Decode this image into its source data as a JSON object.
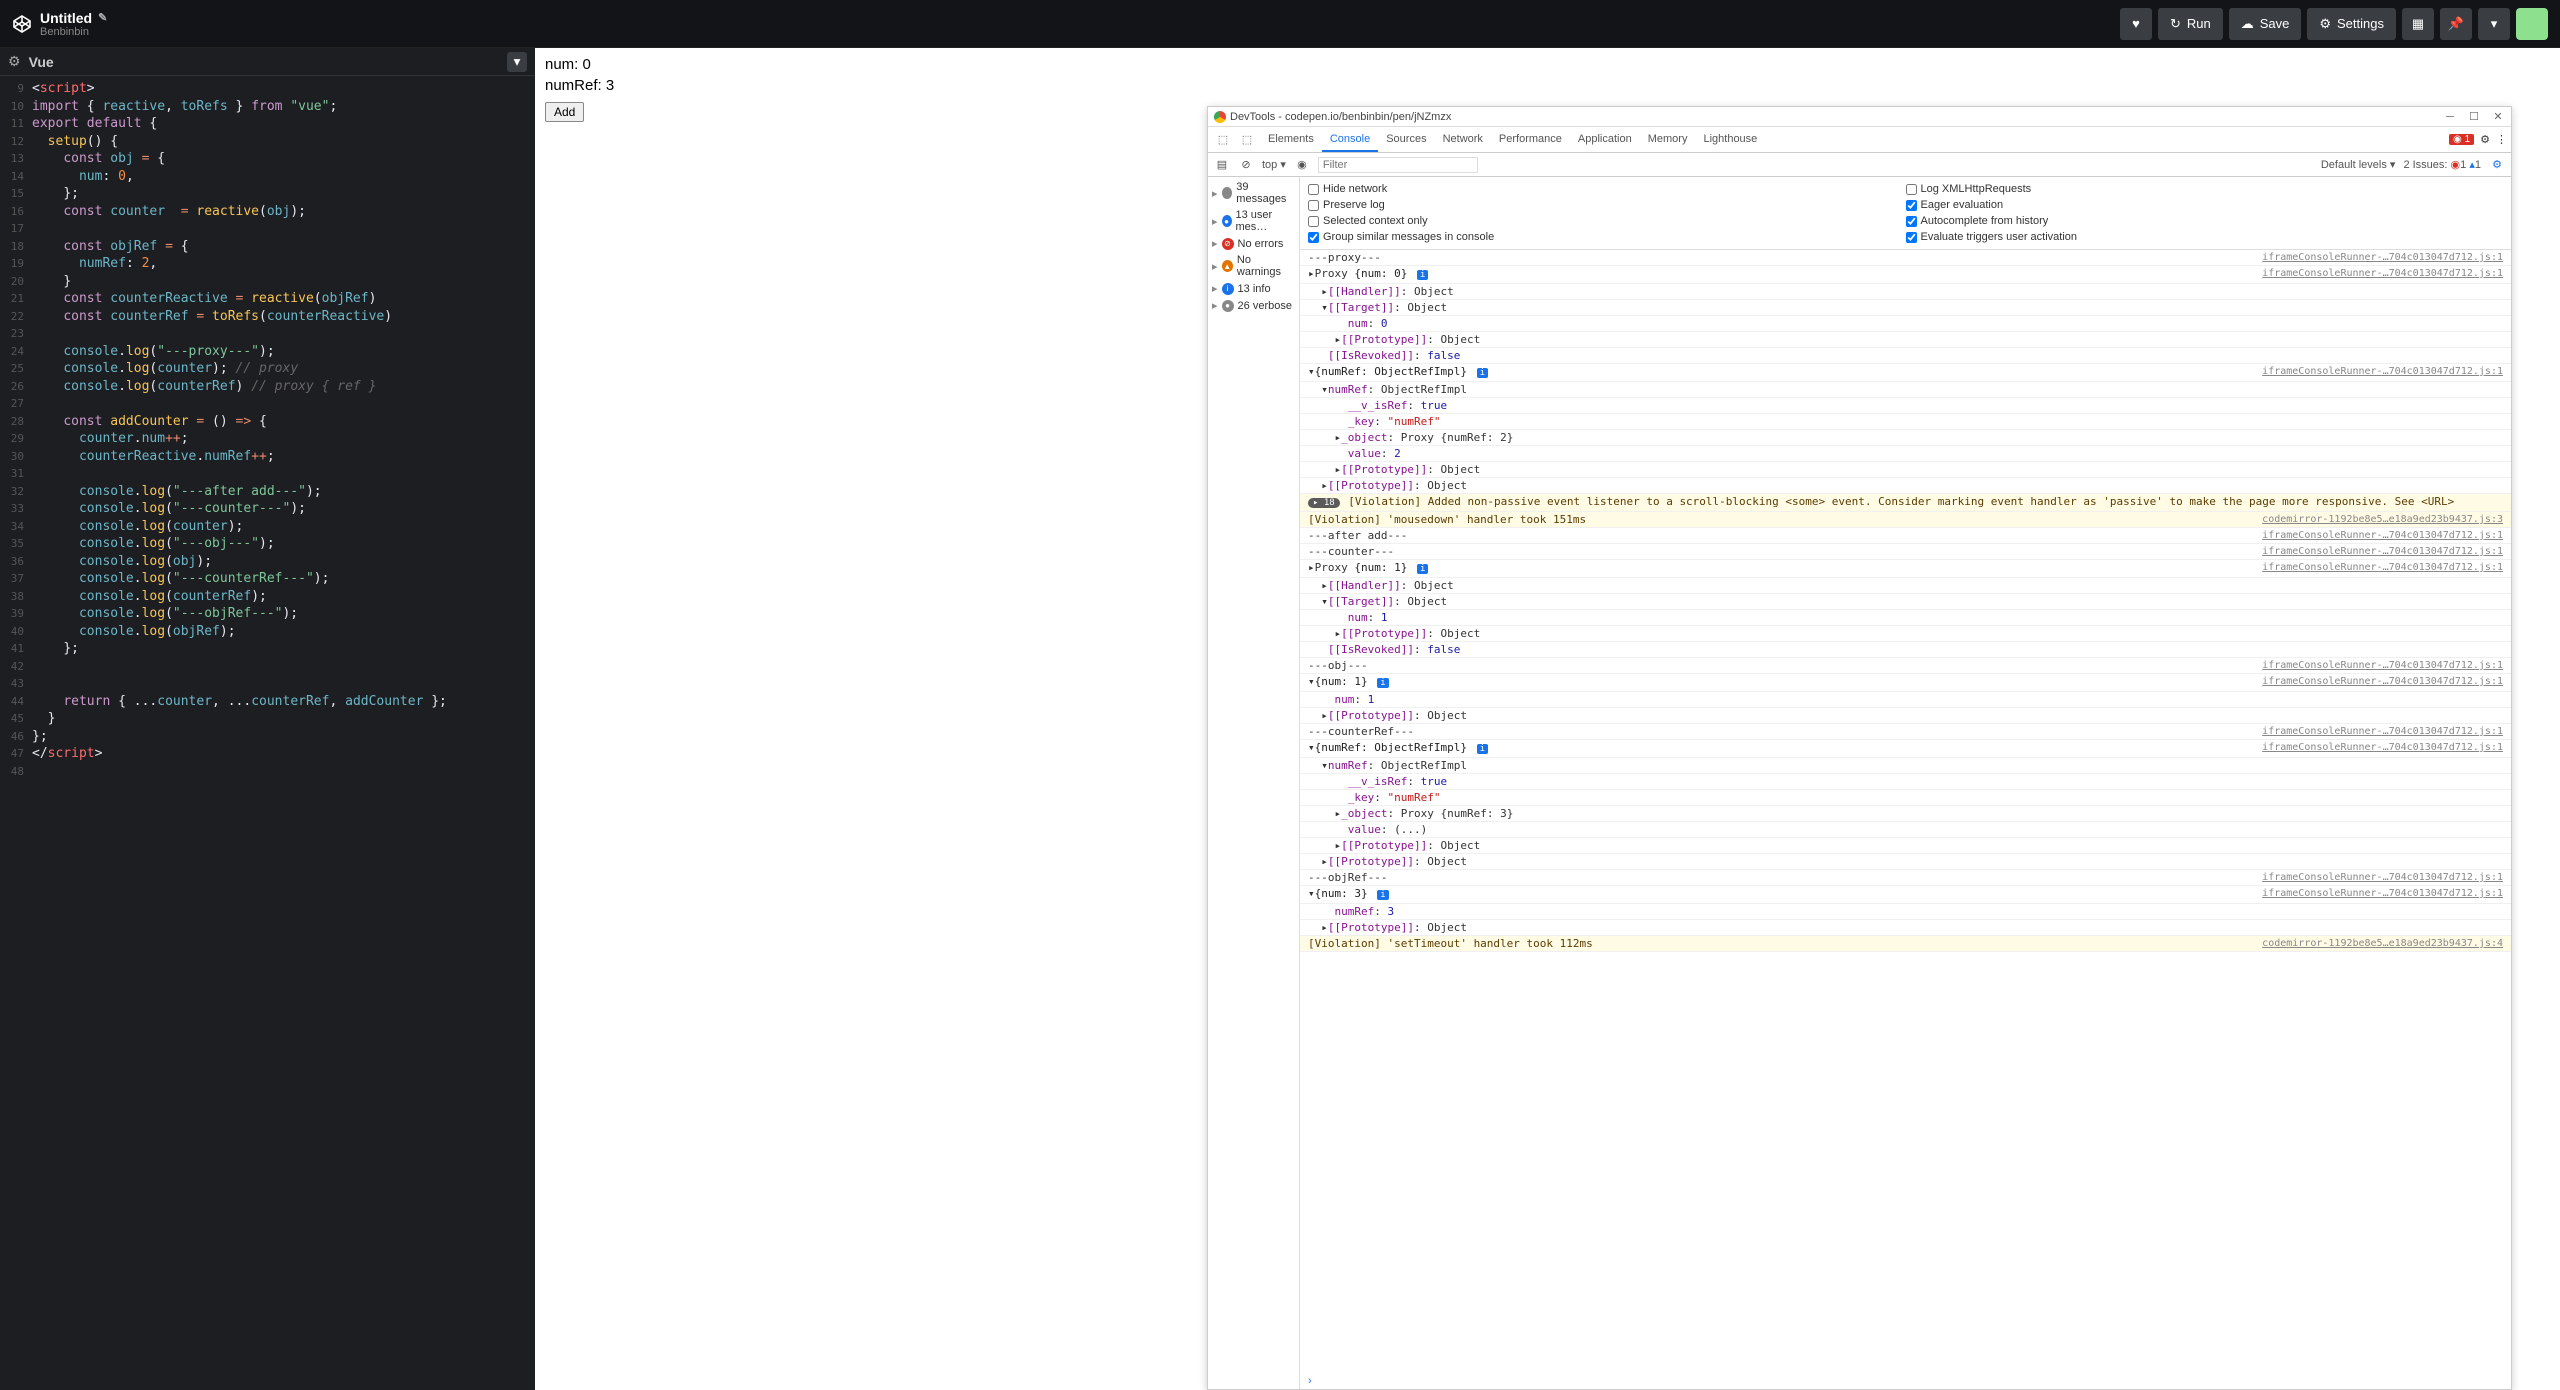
{
  "header": {
    "title": "Untitled",
    "author": "Benbinbin",
    "buttons": {
      "run": "Run",
      "save": "Save",
      "settings": "Settings"
    }
  },
  "panel": {
    "name": "Vue"
  },
  "code": {
    "lines": [
      {
        "n": 9,
        "html": "<span class='c-brace'>&lt;</span><span class='c-tag'>script</span><span class='c-brace'>&gt;</span>"
      },
      {
        "n": 10,
        "html": "<span class='c-kw'>import</span> <span class='c-brace'>{</span> <span class='c-var'>reactive</span><span class='c-brace'>,</span> <span class='c-var'>toRefs</span> <span class='c-brace'>}</span> <span class='c-kw'>from</span> <span class='c-str'>\"vue\"</span><span class='c-brace'>;</span>"
      },
      {
        "n": 11,
        "html": "<span class='c-kw'>export</span> <span class='c-kw'>default</span> <span class='c-brace'>{</span>"
      },
      {
        "n": 12,
        "html": "  <span class='c-fn'>setup</span><span class='c-brace'>() {</span>"
      },
      {
        "n": 13,
        "html": "    <span class='c-kw'>const</span> <span class='c-var'>obj</span> <span class='c-op'>=</span> <span class='c-brace'>{</span>"
      },
      {
        "n": 14,
        "html": "      <span class='c-var'>num</span><span class='c-brace'>:</span> <span class='c-num'>0</span><span class='c-brace'>,</span>"
      },
      {
        "n": 15,
        "html": "    <span class='c-brace'>};</span>"
      },
      {
        "n": 16,
        "html": "    <span class='c-kw'>const</span> <span class='c-var'>counter</span>  <span class='c-op'>=</span> <span class='c-fn'>reactive</span><span class='c-brace'>(</span><span class='c-var'>obj</span><span class='c-brace'>);</span>"
      },
      {
        "n": 17,
        "html": ""
      },
      {
        "n": 18,
        "html": "    <span class='c-kw'>const</span> <span class='c-var'>objRef</span> <span class='c-op'>=</span> <span class='c-brace'>{</span>"
      },
      {
        "n": 19,
        "html": "      <span class='c-var'>numRef</span><span class='c-brace'>:</span> <span class='c-num'>2</span><span class='c-brace'>,</span>"
      },
      {
        "n": 20,
        "html": "    <span class='c-brace'>}</span>"
      },
      {
        "n": 21,
        "html": "    <span class='c-kw'>const</span> <span class='c-var'>counterReactive</span> <span class='c-op'>=</span> <span class='c-fn'>reactive</span><span class='c-brace'>(</span><span class='c-var'>objRef</span><span class='c-brace'>)</span>"
      },
      {
        "n": 22,
        "html": "    <span class='c-kw'>const</span> <span class='c-var'>counterRef</span> <span class='c-op'>=</span> <span class='c-fn'>toRefs</span><span class='c-brace'>(</span><span class='c-var'>counterReactive</span><span class='c-brace'>)</span>"
      },
      {
        "n": 23,
        "html": ""
      },
      {
        "n": 24,
        "html": "    <span class='c-var'>console</span><span class='c-brace'>.</span><span class='c-fn'>log</span><span class='c-brace'>(</span><span class='c-str'>\"---proxy---\"</span><span class='c-brace'>);</span>"
      },
      {
        "n": 25,
        "html": "    <span class='c-var'>console</span><span class='c-brace'>.</span><span class='c-fn'>log</span><span class='c-brace'>(</span><span class='c-var'>counter</span><span class='c-brace'>);</span> <span class='c-comment'>// proxy</span>"
      },
      {
        "n": 26,
        "html": "    <span class='c-var'>console</span><span class='c-brace'>.</span><span class='c-fn'>log</span><span class='c-brace'>(</span><span class='c-var'>counterRef</span><span class='c-brace'>)</span> <span class='c-comment'>// proxy { ref }</span>"
      },
      {
        "n": 27,
        "html": ""
      },
      {
        "n": 28,
        "html": "    <span class='c-kw'>const</span> <span class='c-fn'>addCounter</span> <span class='c-op'>=</span> <span class='c-brace'>()</span> <span class='c-op'>=&gt;</span> <span class='c-brace'>{</span>"
      },
      {
        "n": 29,
        "html": "      <span class='c-var'>counter</span><span class='c-brace'>.</span><span class='c-var'>num</span><span class='c-op'>++</span><span class='c-brace'>;</span>"
      },
      {
        "n": 30,
        "html": "      <span class='c-var'>counterReactive</span><span class='c-brace'>.</span><span class='c-var'>numRef</span><span class='c-op'>++</span><span class='c-brace'>;</span>"
      },
      {
        "n": 31,
        "html": ""
      },
      {
        "n": 32,
        "html": "      <span class='c-var'>console</span><span class='c-brace'>.</span><span class='c-fn'>log</span><span class='c-brace'>(</span><span class='c-str'>\"---after add---\"</span><span class='c-brace'>);</span>"
      },
      {
        "n": 33,
        "html": "      <span class='c-var'>console</span><span class='c-brace'>.</span><span class='c-fn'>log</span><span class='c-brace'>(</span><span class='c-str'>\"---counter---\"</span><span class='c-brace'>);</span>"
      },
      {
        "n": 34,
        "html": "      <span class='c-var'>console</span><span class='c-brace'>.</span><span class='c-fn'>log</span><span class='c-brace'>(</span><span class='c-var'>counter</span><span class='c-brace'>);</span>"
      },
      {
        "n": 35,
        "html": "      <span class='c-var'>console</span><span class='c-brace'>.</span><span class='c-fn'>log</span><span class='c-brace'>(</span><span class='c-str'>\"---obj---\"</span><span class='c-brace'>);</span>"
      },
      {
        "n": 36,
        "html": "      <span class='c-var'>console</span><span class='c-brace'>.</span><span class='c-fn'>log</span><span class='c-brace'>(</span><span class='c-var'>obj</span><span class='c-brace'>);</span>"
      },
      {
        "n": 37,
        "html": "      <span class='c-var'>console</span><span class='c-brace'>.</span><span class='c-fn'>log</span><span class='c-brace'>(</span><span class='c-str'>\"---counterRef---\"</span><span class='c-brace'>);</span>"
      },
      {
        "n": 38,
        "html": "      <span class='c-var'>console</span><span class='c-brace'>.</span><span class='c-fn'>log</span><span class='c-brace'>(</span><span class='c-var'>counterRef</span><span class='c-brace'>);</span>"
      },
      {
        "n": 39,
        "html": "      <span class='c-var'>console</span><span class='c-brace'>.</span><span class='c-fn'>log</span><span class='c-brace'>(</span><span class='c-str'>\"---objRef---\"</span><span class='c-brace'>);</span>"
      },
      {
        "n": 40,
        "html": "      <span class='c-var'>console</span><span class='c-brace'>.</span><span class='c-fn'>log</span><span class='c-brace'>(</span><span class='c-var'>objRef</span><span class='c-brace'>);</span>"
      },
      {
        "n": 41,
        "html": "    <span class='c-brace'>};</span>"
      },
      {
        "n": 42,
        "html": ""
      },
      {
        "n": 43,
        "html": ""
      },
      {
        "n": 44,
        "html": "    <span class='c-kw'>return</span> <span class='c-brace'>{ ...</span><span class='c-var'>counter</span><span class='c-brace'>, ...</span><span class='c-var'>counterRef</span><span class='c-brace'>,</span> <span class='c-var'>addCounter</span> <span class='c-brace'>};</span>"
      },
      {
        "n": 45,
        "html": "  <span class='c-brace'>}</span>"
      },
      {
        "n": 46,
        "html": "<span class='c-brace'>};</span>"
      },
      {
        "n": 47,
        "html": "<span class='c-brace'>&lt;/</span><span class='c-tag'>script</span><span class='c-brace'>&gt;</span>"
      },
      {
        "n": 48,
        "html": ""
      }
    ]
  },
  "preview": {
    "num": "num: 0",
    "numRef": "numRef: 3",
    "addBtn": "Add"
  },
  "devtools": {
    "title": "DevTools - codepen.io/benbinbin/pen/jNZmzx",
    "tabs": [
      "Elements",
      "Console",
      "Sources",
      "Network",
      "Performance",
      "Application",
      "Memory",
      "Lighthouse"
    ],
    "activeTab": "Console",
    "errorCount": "1",
    "toolbar": {
      "top": "top ▾",
      "filterPlaceholder": "Filter",
      "levels": "Default levels ▾",
      "issues": "2 Issues:",
      "issueErr": "1",
      "issueWarn": "1"
    },
    "sidebar": [
      {
        "icon": "",
        "text": "39 messages",
        "color": "#888"
      },
      {
        "icon": "●",
        "text": "13 user mes…",
        "color": "#1a73e8"
      },
      {
        "icon": "⊘",
        "text": "No errors",
        "color": "#d93025"
      },
      {
        "icon": "▲",
        "text": "No warnings",
        "color": "#e37400"
      },
      {
        "icon": "i",
        "text": "13 info",
        "color": "#1a73e8"
      },
      {
        "icon": "●",
        "text": "26 verbose",
        "color": "#888"
      }
    ],
    "checkboxes": [
      {
        "label": "Hide network",
        "checked": false
      },
      {
        "label": "Log XMLHttpRequests",
        "checked": false
      },
      {
        "label": "Preserve log",
        "checked": false
      },
      {
        "label": "Eager evaluation",
        "checked": true
      },
      {
        "label": "Selected context only",
        "checked": false
      },
      {
        "label": "Autocomplete from history",
        "checked": true
      },
      {
        "label": "Group similar messages in console",
        "checked": true
      },
      {
        "label": "Evaluate triggers user activation",
        "checked": true
      }
    ],
    "srcLink": "iframeConsoleRunner-…704c013047d712.js:1",
    "srcLink2": "codemirror-1192be8e5…e18a9ed23b9437.js:3",
    "srcLink3": "codemirror-1192be8e5…e18a9ed23b9437.js:4",
    "log": [
      {
        "text": "---proxy---",
        "src": 1
      },
      {
        "text": "▸Proxy <span class='dt-propv'>{num: 0}</span> <span class='dt-info-badge'>i</span>",
        "src": 1,
        "prop": true
      },
      {
        "text": "  ▸<span class='dt-prop'>[[Handler]]</span>: Object"
      },
      {
        "text": "  ▾<span class='dt-prop'>[[Target]]</span>: Object"
      },
      {
        "text": "      <span class='dt-prop'>num</span>: <span class='dt-num2'>0</span>"
      },
      {
        "text": "    ▸<span class='dt-prop'>[[Prototype]]</span>: Object"
      },
      {
        "text": "   <span class='dt-prop'>[[IsRevoked]]</span>: <span class='dt-bool'>false</span>"
      },
      {
        "text": "▾<span class='dt-propv'>{numRef: ObjectRefImpl}</span> <span class='dt-info-badge'>i</span>",
        "src": 1
      },
      {
        "text": "  ▾<span class='dt-prop'>numRef</span>: ObjectRefImpl"
      },
      {
        "text": "      <span class='dt-prop'>__v_isRef</span>: <span class='dt-bool'>true</span>"
      },
      {
        "text": "      <span class='dt-prop'>_key</span>: <span class='dt-str2'>\"numRef\"</span>"
      },
      {
        "text": "    ▸<span class='dt-prop'>_object</span>: Proxy {numRef: 2}"
      },
      {
        "text": "      <span class='dt-prop'>value</span>: <span class='dt-num2'>2</span>"
      },
      {
        "text": "    ▸<span class='dt-prop'>[[Prototype]]</span>: Object"
      },
      {
        "text": "  ▸<span class='dt-prop'>[[Prototype]]</span>: Object"
      },
      {
        "text": "<span class='dt-count-badge'>▸ 18</span> [Violation] Added non-passive event listener to a scroll-blocking &lt;some&gt; event. Consider marking event handler as 'passive' to make the page more responsive. See &lt;URL&gt;",
        "violation": true
      },
      {
        "text": "[Violation] 'mousedown' handler took 151ms",
        "violation": true,
        "src": 2
      },
      {
        "text": "---after add---",
        "src": 1
      },
      {
        "text": "---counter---",
        "src": 1
      },
      {
        "text": "▸Proxy <span class='dt-propv'>{num: 1}</span> <span class='dt-info-badge'>i</span>",
        "src": 1,
        "prop": true
      },
      {
        "text": "  ▸<span class='dt-prop'>[[Handler]]</span>: Object"
      },
      {
        "text": "  ▾<span class='dt-prop'>[[Target]]</span>: Object"
      },
      {
        "text": "      <span class='dt-prop'>num</span>: <span class='dt-num2'>1</span>"
      },
      {
        "text": "    ▸<span class='dt-prop'>[[Prototype]]</span>: Object"
      },
      {
        "text": "   <span class='dt-prop'>[[IsRevoked]]</span>: <span class='dt-bool'>false</span>"
      },
      {
        "text": "---obj---",
        "src": 1
      },
      {
        "text": "▾<span class='dt-propv'>{num: 1}</span> <span class='dt-info-badge'>i</span>",
        "src": 1
      },
      {
        "text": "    <span class='dt-prop'>num</span>: <span class='dt-num2'>1</span>"
      },
      {
        "text": "  ▸<span class='dt-prop'>[[Prototype]]</span>: Object"
      },
      {
        "text": "---counterRef---",
        "src": 1
      },
      {
        "text": "▾<span class='dt-propv'>{numRef: ObjectRefImpl}</span> <span class='dt-info-badge'>i</span>",
        "src": 1
      },
      {
        "text": "  ▾<span class='dt-prop'>numRef</span>: ObjectRefImpl"
      },
      {
        "text": "      <span class='dt-prop'>__v_isRef</span>: <span class='dt-bool'>true</span>"
      },
      {
        "text": "      <span class='dt-prop'>_key</span>: <span class='dt-str2'>\"numRef\"</span>"
      },
      {
        "text": "    ▸<span class='dt-prop'>_object</span>: Proxy {numRef: 3}"
      },
      {
        "text": "      <span class='dt-prop'>value</span>: (...)"
      },
      {
        "text": "    ▸<span class='dt-prop'>[[Prototype]]</span>: Object"
      },
      {
        "text": "  ▸<span class='dt-prop'>[[Prototype]]</span>: Object"
      },
      {
        "text": "---objRef---",
        "src": 1
      },
      {
        "text": "▾<span class='dt-propv'>{num: 3}</span> <span class='dt-info-badge'>i</span>",
        "src": 1
      },
      {
        "text": "    <span class='dt-prop'>numRef</span>: <span class='dt-num2'>3</span>"
      },
      {
        "text": "  ▸<span class='dt-prop'>[[Prototype]]</span>: Object"
      },
      {
        "text": "[Violation] 'setTimeout' handler took 112ms",
        "violation": true,
        "src": 3
      }
    ]
  }
}
